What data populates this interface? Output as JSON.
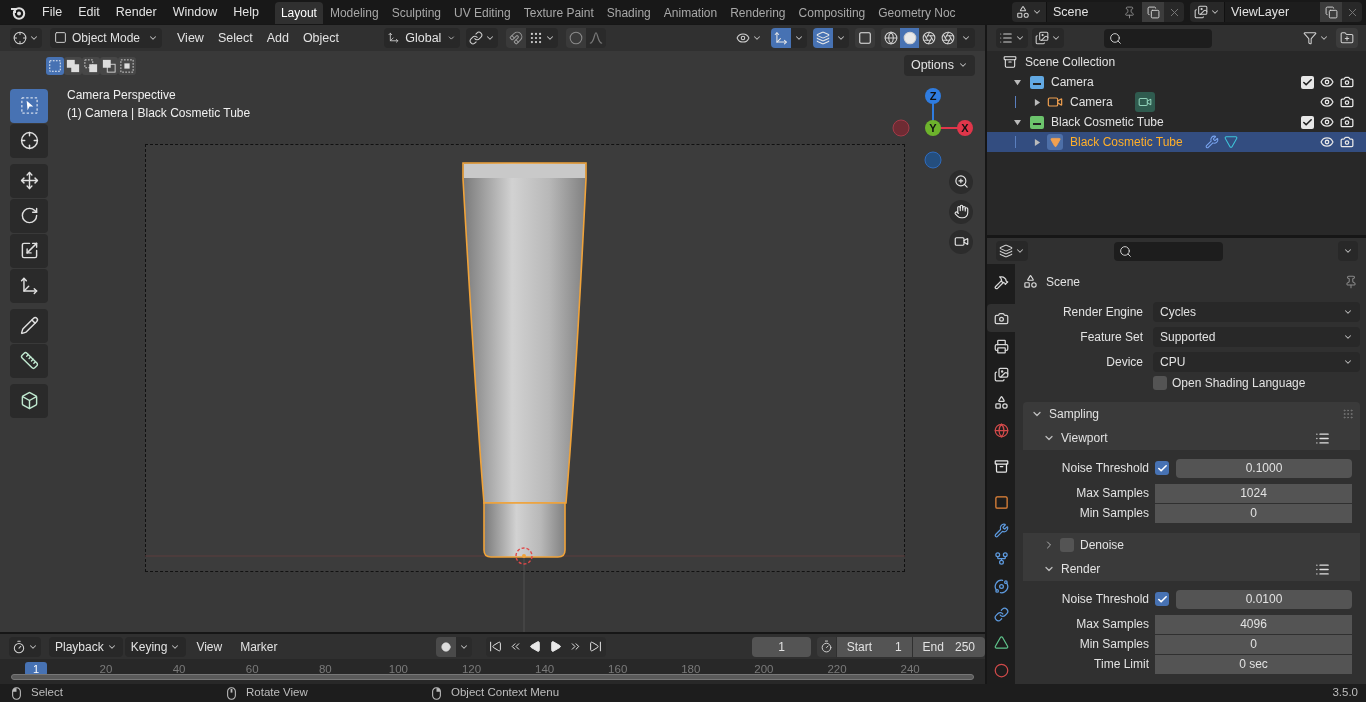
{
  "top_menu": [
    "File",
    "Edit",
    "Render",
    "Window",
    "Help"
  ],
  "workspaces": [
    {
      "label": "Layout",
      "selected": true
    },
    {
      "label": "Modeling",
      "selected": false
    },
    {
      "label": "Sculpting",
      "selected": false
    },
    {
      "label": "UV Editing",
      "selected": false
    },
    {
      "label": "Texture Paint",
      "selected": false
    },
    {
      "label": "Shading",
      "selected": false
    },
    {
      "label": "Animation",
      "selected": false
    },
    {
      "label": "Rendering",
      "selected": false
    },
    {
      "label": "Compositing",
      "selected": false
    },
    {
      "label": "Geometry Noc",
      "selected": false
    }
  ],
  "scene": "Scene",
  "view_layer": "ViewLayer",
  "viewport": {
    "mode": "Object Mode",
    "menus": [
      "View",
      "Select",
      "Add",
      "Object"
    ],
    "orientation": "Global",
    "snap": {
      "on": false
    },
    "proportional": {
      "on": false
    },
    "overlay_toggles": [
      {
        "kind": "gizmo",
        "on": true
      },
      {
        "kind": "overlay",
        "on": true
      },
      {
        "kind": "xray",
        "on": false
      }
    ],
    "shading": [
      {
        "kind": "wireframe",
        "selected": false
      },
      {
        "kind": "solid",
        "selected": true
      },
      {
        "kind": "material",
        "selected": false
      },
      {
        "kind": "rendered",
        "selected": false
      }
    ],
    "select_modes": [
      {
        "kind": "set",
        "selected": true
      },
      {
        "kind": "extend",
        "selected": false
      },
      {
        "kind": "subtract",
        "selected": false
      },
      {
        "kind": "difference",
        "selected": false
      },
      {
        "kind": "intersect",
        "selected": false
      }
    ],
    "options": "Options",
    "info": [
      "Camera Perspective",
      "(1) Camera | Black Cosmetic Tube"
    ],
    "tool_groups": [
      [
        {
          "kind": "select",
          "selected": true
        },
        {
          "kind": "cursor",
          "selected": false
        }
      ],
      [
        {
          "kind": "move",
          "selected": false
        },
        {
          "kind": "rotate",
          "selected": false
        },
        {
          "kind": "scale",
          "selected": false
        },
        {
          "kind": "transform",
          "selected": false
        }
      ],
      [
        {
          "kind": "annotate",
          "selected": false
        },
        {
          "kind": "measure",
          "selected": false
        }
      ],
      [
        {
          "kind": "add",
          "selected": false
        }
      ]
    ],
    "gizmo_axes": [
      {
        "label": "Z"
      },
      {
        "label": "Y"
      },
      {
        "label": "X"
      }
    ]
  },
  "outliner": {
    "root": "Scene Collection",
    "collections": [
      {
        "name": "Camera",
        "color": "#62a9e3",
        "expanded": true,
        "included": true,
        "objects": [
          {
            "name": "Camera",
            "kind": "camera",
            "selected": false,
            "expanded": false
          }
        ]
      },
      {
        "name": "Black Cosmetic Tube",
        "color": "#6cc46c",
        "expanded": true,
        "included": true,
        "objects": [
          {
            "name": "Black Cosmetic Tube",
            "kind": "mesh",
            "selected": true,
            "expanded": false
          }
        ]
      }
    ]
  },
  "properties": {
    "context": "Scene",
    "tab_groups": [
      [
        {
          "kind": "tool",
          "selected": false
        }
      ],
      [
        {
          "kind": "render",
          "selected": true
        },
        {
          "kind": "output",
          "selected": false
        },
        {
          "kind": "view-layer",
          "selected": false
        },
        {
          "kind": "scene",
          "selected": false
        },
        {
          "kind": "world",
          "selected": false
        }
      ],
      [
        {
          "kind": "collection",
          "selected": false
        }
      ],
      [
        {
          "kind": "object",
          "selected": false
        },
        {
          "kind": "modifiers",
          "selected": false
        },
        {
          "kind": "particles",
          "selected": false
        },
        {
          "kind": "physics",
          "selected": false
        },
        {
          "kind": "constraints",
          "selected": false
        },
        {
          "kind": "data",
          "selected": false
        },
        {
          "kind": "material",
          "selected": false
        }
      ]
    ],
    "settings": [
      {
        "label": "Render Engine",
        "value": "Cycles"
      },
      {
        "label": "Feature Set",
        "value": "Supported"
      },
      {
        "label": "Device",
        "value": "CPU"
      }
    ],
    "osl": {
      "label": "Open Shading Language",
      "checked": false
    },
    "sampling": {
      "title": "Sampling",
      "expanded": true,
      "subpanels": [
        {
          "title": "Viewport",
          "kind": "plain",
          "expanded": true,
          "fields": [
            {
              "label": "Noise Threshold",
              "kind": "toggle-number",
              "checked": true,
              "value": "0.1000"
            },
            {
              "label": "Max Samples",
              "kind": "number",
              "value": "1024"
            },
            {
              "label": "Min Samples",
              "kind": "number",
              "value": "0"
            }
          ]
        },
        {
          "title": "Denoise",
          "kind": "toggle",
          "checked": false,
          "expanded": false
        },
        {
          "title": "Render",
          "kind": "plain",
          "expanded": true,
          "fields": [
            {
              "label": "Noise Threshold",
              "kind": "toggle-number",
              "checked": true,
              "value": "0.0100"
            },
            {
              "label": "Max Samples",
              "kind": "number",
              "value": "4096"
            },
            {
              "label": "Min Samples",
              "kind": "number",
              "value": "0"
            },
            {
              "label": "Time Limit",
              "kind": "number",
              "value": "0 sec"
            }
          ]
        }
      ]
    }
  },
  "timeline": {
    "menus": [
      {
        "label": "Playback",
        "kind": "dropdown"
      },
      {
        "label": "Keying",
        "kind": "dropdown"
      },
      {
        "label": "View",
        "kind": "menu"
      },
      {
        "label": "Marker",
        "kind": "menu"
      }
    ],
    "auto_key": {
      "on": false
    },
    "current_frame": "1",
    "start_label": "Start",
    "start": "1",
    "end_label": "End",
    "end": "250",
    "playhead": "1",
    "ticks": [
      "20",
      "40",
      "60",
      "80",
      "100",
      "120",
      "140",
      "160",
      "180",
      "200",
      "220",
      "240"
    ]
  },
  "status_bar": {
    "hints": [
      {
        "kind": "left-click",
        "label": "Select"
      },
      {
        "kind": "middle-click",
        "label": "Rotate View"
      },
      {
        "kind": "right-click",
        "label": "Object Context Menu"
      }
    ],
    "version": "3.5.0"
  }
}
